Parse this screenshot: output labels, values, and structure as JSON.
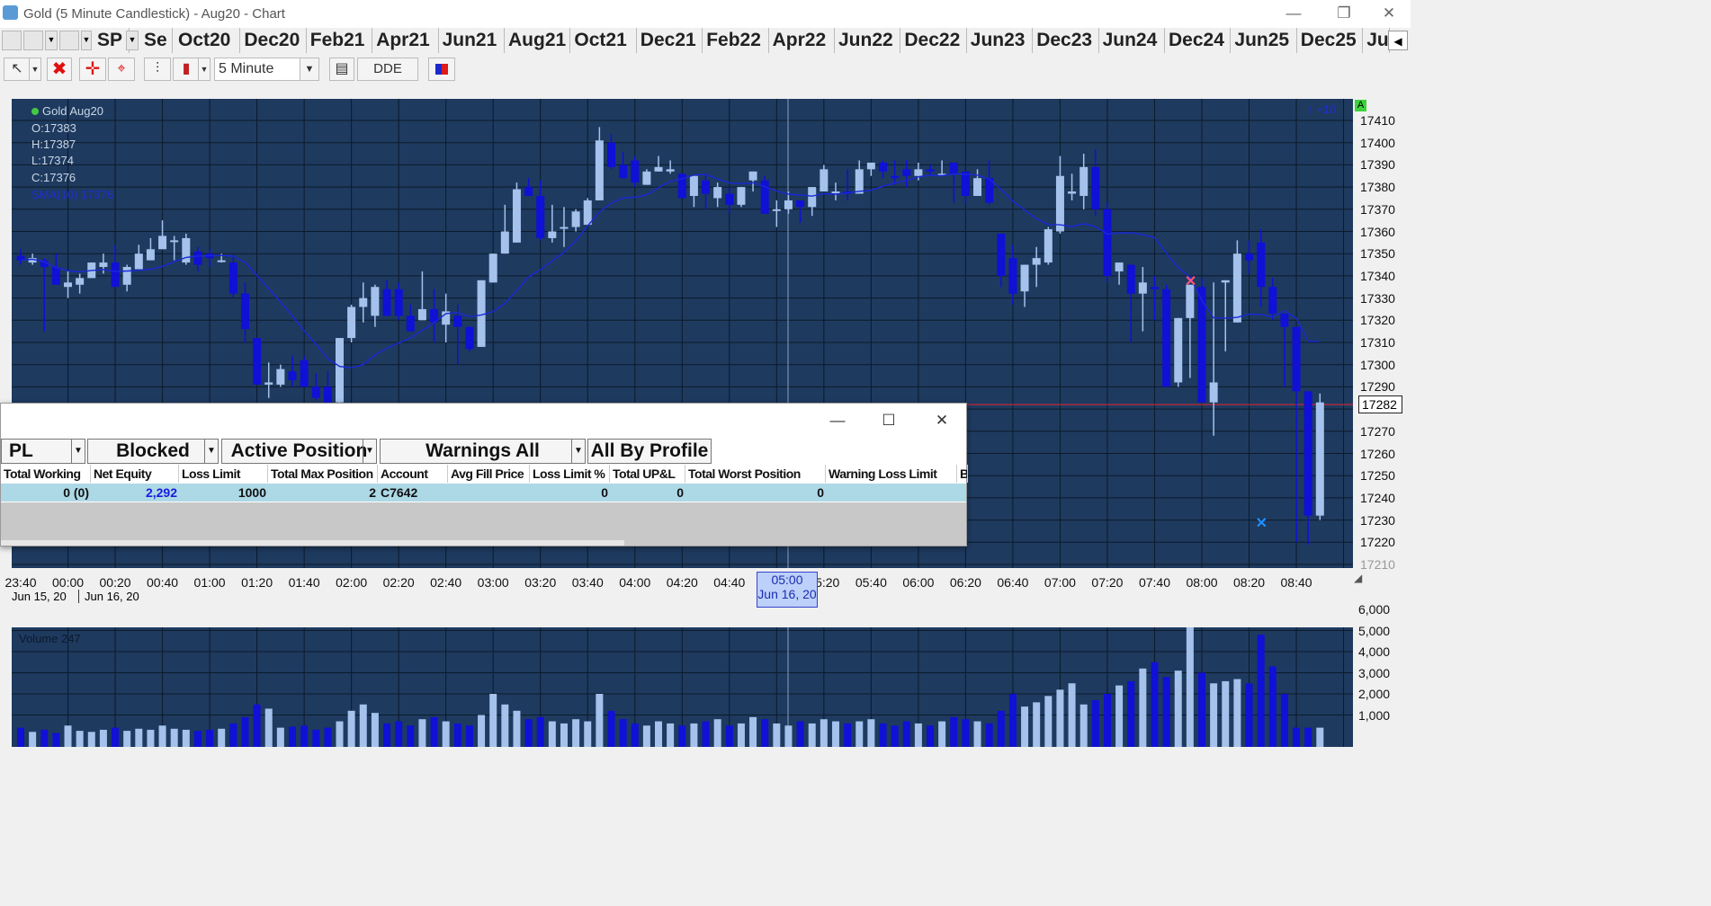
{
  "window": {
    "title": "Gold (5 Minute Candlestick) - Aug20 - Chart"
  },
  "tabbar": {
    "symbol": "SP",
    "partial": "Se",
    "months": [
      "Oct20",
      "Dec20",
      "Feb21",
      "Apr21",
      "Jun21",
      "Aug21",
      "Oct21",
      "Dec21",
      "Feb22",
      "Apr22",
      "Jun22",
      "Dec22",
      "Jun23",
      "Dec23",
      "Jun24",
      "Dec24",
      "Jun25",
      "Dec25",
      "Jun"
    ]
  },
  "toolbar": {
    "interval": "5 Minute",
    "dde_label": "DDE"
  },
  "chart": {
    "legend": {
      "name": "Gold Aug20",
      "open": "O:17383",
      "high": "H:17387",
      "low": "L:17374",
      "close": "C:17376",
      "sma": "SMA(10)  17376"
    },
    "auto_scale_badge": "A",
    "scroll_indicator": "+10",
    "last_price_tag": "17282",
    "cursor_time": "05:00",
    "cursor_date": "Jun 16, 20",
    "colors": {
      "background": "#1e3a5f",
      "up": "#a4c2ec",
      "down": "#1010d6",
      "sma": "#1a28d8",
      "grid": "#0d1a2a",
      "price_line": "#c0283a"
    }
  },
  "price_axis": [
    "17410",
    "17400",
    "17390",
    "17380",
    "17370",
    "17360",
    "17350",
    "17340",
    "17330",
    "17320",
    "17310",
    "17300",
    "17290",
    "17280",
    "17270",
    "17260",
    "17250",
    "17240",
    "17230",
    "17220",
    "17210"
  ],
  "time_axis": {
    "labels": [
      "23:40",
      "00:00",
      "00:20",
      "00:40",
      "01:00",
      "01:20",
      "01:40",
      "02:00",
      "02:20",
      "02:40",
      "03:00",
      "03:20",
      "03:40",
      "04:00",
      "04:20",
      "04:40",
      "05:20",
      "05:40",
      "06:00",
      "06:20",
      "06:40",
      "07:00",
      "07:20",
      "07:40",
      "08:00",
      "08:20",
      "08:40"
    ],
    "date1": "Jun 15, 20",
    "date2": "Jun 16, 20"
  },
  "volume": {
    "legend": "Volume 247",
    "axis": [
      "6,000",
      "5,000",
      "4,000",
      "3,000",
      "2,000",
      "1,000"
    ]
  },
  "panel": {
    "dropdowns": [
      "PL",
      "Blocked",
      "Active Position",
      "Warnings All",
      "All By Profile"
    ],
    "columns": [
      "Total Working",
      "Net Equity",
      "Loss Limit",
      "Total Max Position",
      "Account",
      "Avg Fill Price",
      "Loss Limit %",
      "Total UP&L",
      "Total Worst Position",
      "Warning Loss Limit",
      "B"
    ],
    "row": {
      "total_working": "0 (0)",
      "net_equity": "2,292",
      "loss_limit": "1000",
      "total_max_position": "2",
      "account": "C7642",
      "avg_fill_price": "",
      "loss_limit_pct": "0",
      "total_upl": "0",
      "total_worst_position": "0",
      "warning_loss_limit": ""
    }
  },
  "chart_data": {
    "type": "candlestick",
    "series_name": "Gold Aug20",
    "interval": "5 Minute",
    "x_label_start": "23:40",
    "x_step_minutes": 5,
    "ylim": [
      17210,
      17415
    ],
    "candles": [
      [
        17349,
        17352,
        17345,
        17347
      ],
      [
        17346,
        17350,
        17345,
        17348
      ],
      [
        17347,
        17348,
        17315,
        17344
      ],
      [
        17344,
        17350,
        17340,
        17336
      ],
      [
        17335,
        17342,
        17330,
        17337
      ],
      [
        17336,
        17341,
        17332,
        17339
      ],
      [
        17339,
        17346,
        17340,
        17346
      ],
      [
        17344,
        17350,
        17341,
        17346
      ],
      [
        17346,
        17354,
        17335,
        17335
      ],
      [
        17336,
        17345,
        17333,
        17344
      ],
      [
        17343,
        17354,
        17343,
        17350
      ],
      [
        17347,
        17357,
        17347,
        17352
      ],
      [
        17352,
        17365,
        17352,
        17358
      ],
      [
        17356,
        17358,
        17347,
        17356
      ],
      [
        17346,
        17359,
        17345,
        17357
      ],
      [
        17351,
        17353,
        17342,
        17345
      ],
      [
        17350,
        17352,
        17344,
        17348
      ],
      [
        17347,
        17350,
        17346,
        17347
      ],
      [
        17346,
        17350,
        17330,
        17332
      ],
      [
        17332,
        17337,
        17310,
        17316
      ],
      [
        17312,
        17312,
        17293,
        17291
      ],
      [
        17291,
        17301,
        17285,
        17292
      ],
      [
        17291,
        17300,
        17290,
        17298
      ],
      [
        17297,
        17304,
        17290,
        17293
      ],
      [
        17302,
        17304,
        17290,
        17290
      ],
      [
        17290,
        17296,
        17284,
        17285
      ],
      [
        17290,
        17297,
        17283,
        17283
      ],
      [
        17283,
        17306,
        17282,
        17312
      ],
      [
        17312,
        17327,
        17310,
        17326
      ],
      [
        17326,
        17337,
        17319,
        17330
      ],
      [
        17322,
        17336,
        17317,
        17335
      ],
      [
        17334,
        17338,
        17322,
        17322
      ],
      [
        17334,
        17337,
        17320,
        17322
      ],
      [
        17322,
        17327,
        17316,
        17315
      ],
      [
        17320,
        17342,
        17320,
        17325
      ],
      [
        17325,
        17334,
        17310,
        17319
      ],
      [
        17318,
        17332,
        17310,
        17324
      ],
      [
        17322,
        17327,
        17300,
        17317
      ],
      [
        17317,
        17312,
        17306,
        17307
      ],
      [
        17308,
        17338,
        17308,
        17338
      ],
      [
        17337,
        17348,
        17337,
        17350
      ],
      [
        17350,
        17372,
        17350,
        17360
      ],
      [
        17355,
        17382,
        17355,
        17379
      ],
      [
        17380,
        17384,
        17376,
        17376
      ],
      [
        17376,
        17383,
        17356,
        17357
      ],
      [
        17357,
        17372,
        17355,
        17360
      ],
      [
        17362,
        17371,
        17353,
        17362
      ],
      [
        17362,
        17370,
        17360,
        17369
      ],
      [
        17363,
        17375,
        17364,
        17374
      ],
      [
        17374,
        17407,
        17374,
        17401
      ],
      [
        17400,
        17404,
        17388,
        17389
      ],
      [
        17390,
        17396,
        17385,
        17384
      ],
      [
        17392,
        17394,
        17380,
        17382
      ],
      [
        17381,
        17388,
        17383,
        17387
      ],
      [
        17387,
        17394,
        17387,
        17389
      ],
      [
        17387,
        17392,
        17386,
        17388
      ],
      [
        17386,
        17383,
        17380,
        17375
      ],
      [
        17376,
        17384,
        17371,
        17385
      ],
      [
        17383,
        17386,
        17370,
        17377
      ],
      [
        17375,
        17382,
        17371,
        17380
      ],
      [
        17377,
        17380,
        17368,
        17372
      ],
      [
        17372,
        17380,
        17371,
        17380
      ],
      [
        17383,
        17387,
        17378,
        17387
      ],
      [
        17383,
        17385,
        17371,
        17368
      ],
      [
        17370,
        17374,
        17362,
        17370
      ],
      [
        17370,
        17378,
        17368,
        17374
      ],
      [
        17374,
        17374,
        17364,
        17371
      ],
      [
        17371,
        17380,
        17367,
        17380
      ],
      [
        17378,
        17390,
        17378,
        17388
      ],
      [
        17378,
        17382,
        17374,
        17378
      ],
      [
        17378,
        17388,
        17374,
        17377
      ],
      [
        17377,
        17392,
        17377,
        17388
      ],
      [
        17388,
        17391,
        17385,
        17391
      ],
      [
        17391,
        17392,
        17384,
        17387
      ],
      [
        17385,
        17392,
        17381,
        17384
      ],
      [
        17388,
        17392,
        17380,
        17385
      ],
      [
        17385,
        17391,
        17383,
        17388
      ],
      [
        17388,
        17390,
        17385,
        17387
      ],
      [
        17386,
        17392,
        17385,
        17386
      ],
      [
        17391,
        17387,
        17373,
        17386
      ],
      [
        17387,
        17384,
        17372,
        17376
      ],
      [
        17376,
        17388,
        17376,
        17384
      ],
      [
        17384,
        17392,
        17372,
        17373
      ],
      [
        17359,
        17352,
        17335,
        17340
      ],
      [
        17348,
        17354,
        17327,
        17332
      ],
      [
        17333,
        17336,
        17326,
        17345
      ],
      [
        17345,
        17353,
        17335,
        17348
      ],
      [
        17346,
        17362,
        17345,
        17361
      ],
      [
        17360,
        17394,
        17359,
        17385
      ],
      [
        17377,
        17386,
        17374,
        17378
      ],
      [
        17376,
        17395,
        17370,
        17389
      ],
      [
        17389,
        17397,
        17367,
        17370
      ],
      [
        17370,
        17373,
        17337,
        17340
      ],
      [
        17342,
        17346,
        17336,
        17346
      ],
      [
        17345,
        17343,
        17310,
        17332
      ],
      [
        17332,
        17344,
        17315,
        17337
      ],
      [
        17335,
        17340,
        17320,
        17334
      ],
      [
        17334,
        17336,
        17291,
        17290
      ],
      [
        17292,
        17320,
        17290,
        17321
      ],
      [
        17321,
        17336,
        17294,
        17336
      ],
      [
        17335,
        17339,
        17288,
        17283
      ],
      [
        17283,
        17337,
        17268,
        17292
      ],
      [
        17337,
        17335,
        17306,
        17338
      ],
      [
        17319,
        17356,
        17320,
        17350
      ],
      [
        17350,
        17356,
        17341,
        17347
      ],
      [
        17355,
        17361,
        17326,
        17335
      ],
      [
        17335,
        17339,
        17320,
        17323
      ],
      [
        17323,
        17319,
        17290,
        17317
      ],
      [
        17317,
        17292,
        17220,
        17288
      ],
      [
        17288,
        17288,
        17219,
        17232
      ],
      [
        17232,
        17287,
        17230,
        17283
      ]
    ],
    "sma_name": "SMA(10)",
    "sma_last": 17376
  }
}
